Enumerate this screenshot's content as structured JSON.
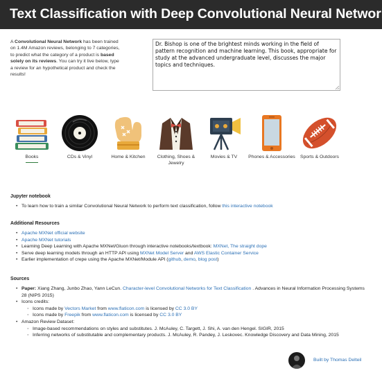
{
  "header": {
    "title": "Text Classification with Deep Convolutional Neural Networks"
  },
  "intro": {
    "p1": "A ",
    "cnn": "Convolutional Neural Network",
    "p2": " has been trained on 1.4M Amazon reviews, belonging to 7 categories, to predict what the category of a product is ",
    "bold": "based solely on its reviews",
    "p3": ". You can try it live below, type a review for an hypothetical product and check the results!"
  },
  "review": {
    "value": "Dr. Bishop is one of the brightest minds working in the field of pattern recognition and machine learning. This book, appropriate for study at the advanced undergraduate level, discusses the major topics and techniques."
  },
  "categories": [
    {
      "label": "Books",
      "icon": "books-icon",
      "selected": true
    },
    {
      "label": "CDs & Vinyl",
      "icon": "vinyl-record-icon",
      "selected": false
    },
    {
      "label": "Home & Kitchen",
      "icon": "oven-mitt-icon",
      "selected": false
    },
    {
      "label": "Clothing, Shoes & Jewelry",
      "icon": "tuxedo-icon",
      "selected": false
    },
    {
      "label": "Movies & TV",
      "icon": "movie-camera-icon",
      "selected": false
    },
    {
      "label": "Phones & Accessories",
      "icon": "phone-icon",
      "selected": false
    },
    {
      "label": "Sports & Outdoors",
      "icon": "football-icon",
      "selected": false
    }
  ],
  "jupyter": {
    "title": "Jupyter notebook",
    "text": "To learn how to train a similar Convolutional Neural Network to perform text classification, follow ",
    "link": "this interactive notebook"
  },
  "resources": {
    "title": "Additional Resources",
    "items": {
      "official": "Apache MXNet official website",
      "tutorials": "Apache MXNet tutorials",
      "gluon_text": "Learning Deep Learning with Apache MXNet/Gluon through interactive notebooks/textbook: ",
      "gluon_link": "MXNet, The straight dope",
      "serve_text": "Serve deep learning models through an HTTP API using ",
      "serve_link1": "MXNet Model Server",
      "serve_and": " and ",
      "serve_link2": "AWS Elastic Container Service",
      "earlier_text": "Earlier implementation of crepe using the Apache MXNet/Module API (",
      "earlier_github": "github",
      "earlier_comma1": ", ",
      "earlier_demo": "demo",
      "earlier_comma2": ", ",
      "earlier_blog": "blog post",
      "earlier_close": ")"
    }
  },
  "sources": {
    "title": "Sources",
    "paper_label": "Paper:",
    "paper_authors": " Xiang Zhang, Junbo Zhao, Yann LeCun. ",
    "paper_link": "Character-level Convolutional Networks for Text Classification",
    "paper_rest": " . Advances in Neural Information Processing Systems 28 (NIPS 2015)",
    "icons_credits": "Icons credits:",
    "credit1_a": "Icons made by ",
    "credit1_author": "Vectors Market",
    "credit1_from": " from ",
    "credit1_site": "www.flaticon.com",
    "credit1_lic": " is licensed by ",
    "credit1_cc": "CC 3.0 BY",
    "credit2_a": "Icons made by ",
    "credit2_author": "Freepik",
    "credit2_from": " from ",
    "credit2_site": "www.flaticon.com",
    "credit2_lic": " is licensed by ",
    "credit2_cc": "CC 3.0 BY",
    "dataset": "Amazon Review Dataset:",
    "dataset1": "Image-based recommendations on styles and substitutes. J. McAuley, C. Targett, J. Shi, A. van den Hengel. SIGIR, 2015",
    "dataset2": "Inferring networks of substitutable and complementary products. J. McAuley, R. Pandey, J. Leskovec. Knowledge Discovery and Data Mining, 2015"
  },
  "footer": {
    "built_by": "Built by Thomas Delteil"
  },
  "colors": {
    "header_bg": "#2b2b2b",
    "link": "#2a6fb5",
    "selected_underline": "#2f7a3c"
  }
}
